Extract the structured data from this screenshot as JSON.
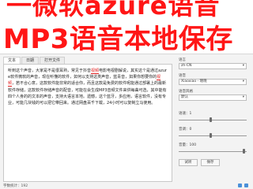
{
  "banner": {
    "line1": "一微软azure语音",
    "line2": "MP3语音本地保存"
  },
  "tabs": [
    {
      "label": "文本"
    },
    {
      "label": "日期"
    },
    {
      "label": "打开文件"
    }
  ],
  "editor": {
    "text_parts": [
      "听到这个声音，大家是不是很耳熟，常见于抖音",
      "视频",
      "电影电视剧解说，其实这个是通过azure软件微软的声音，现在听懂的软件，如何以支持这类声音，蓝青音，如果你想要你的",
      "视频",
      "，若不合心意，这款软件能非常的适合你，而且这款是免费的软件呢能通过部署上的最新软件存储，这款软件存储声音的配音，可能在会生成MP3音频文件来供每曲可选，其中能有四个人身的的文本的声音，支持大语言本地。遗憾，这个蓝牙，多应用，语言软件，没有专业，可能几块钱的可以把它带回来。通过网盘百千下载，24小时可以复制立马使用。"
    ]
  },
  "panel": {
    "language_label": "语言",
    "language_value": "zh-CN",
    "voice_label": "语音",
    "voice_value": "Xiaoxiao - 晓晓",
    "style_label": "语音风格",
    "style_value": "默认",
    "rate_label": "语速",
    "rate_value": "1",
    "pitch_label": "音调",
    "pitch_value": "0",
    "volume_label": "音量",
    "volume_value": "100",
    "listen_button": "试听",
    "save_button": "保存"
  },
  "sliders": {
    "rate_fraction": 0.47,
    "pitch_fraction": 0.47,
    "volume_fraction": 0.97
  },
  "statusbar": {
    "text": "字数统计：192"
  }
}
